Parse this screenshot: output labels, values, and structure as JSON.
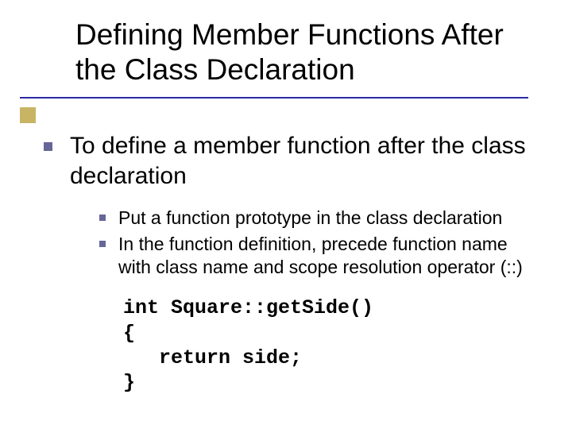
{
  "title": "Defining Member Functions After the Class Declaration",
  "lvl1": "To define a member function after the class declaration",
  "sub1": "Put a function prototype in the class declaration",
  "sub2": "In the function definition, precede function name with class name and scope resolution operator (::)",
  "code1": "int Square::getSide()",
  "code2": "{",
  "code3": "   return side;",
  "code4": "}"
}
